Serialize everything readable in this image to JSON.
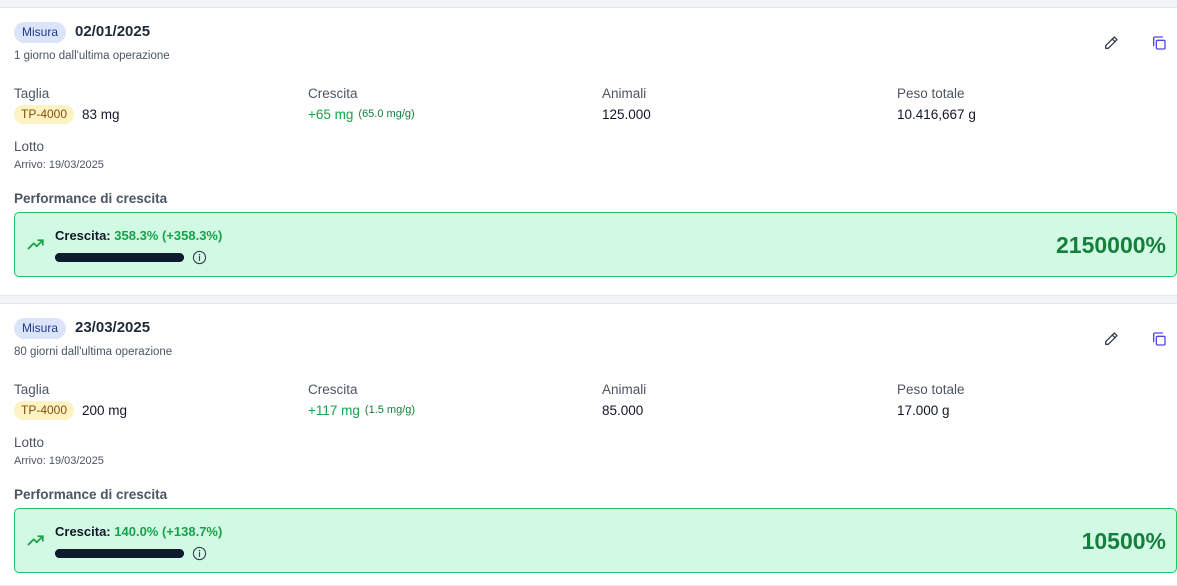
{
  "records": [
    {
      "badge": "Misura",
      "date": "02/01/2025",
      "since": "1 giorno dall'ultima operazione",
      "taglia_label": "Taglia",
      "taglia_tag": "TP-4000",
      "taglia_value": "83 mg",
      "crescita_label": "Crescita",
      "crescita_value": "+65 mg",
      "crescita_rate": "(65.0 mg/g)",
      "animali_label": "Animali",
      "animali_value": "125.000",
      "peso_label": "Peso totale",
      "peso_value": "10.416,667 g",
      "lotto_label": "Lotto",
      "arrivo": "Arrivo: 19/03/2025",
      "perf_title": "Performance di crescita",
      "perf_prefix": "Crescita:",
      "perf_value": "358.3% (+358.3%)",
      "perf_bar_fraction": 1.0,
      "perf_big": "2150000%"
    },
    {
      "badge": "Misura",
      "date": "23/03/2025",
      "since": "80 giorni dall'ultima operazione",
      "taglia_label": "Taglia",
      "taglia_tag": "TP-4000",
      "taglia_value": "200 mg",
      "crescita_label": "Crescita",
      "crescita_value": "+117 mg",
      "crescita_rate": "(1.5 mg/g)",
      "animali_label": "Animali",
      "animali_value": "85.000",
      "peso_label": "Peso totale",
      "peso_value": "17.000 g",
      "lotto_label": "Lotto",
      "arrivo": "Arrivo: 19/03/2025",
      "perf_title": "Performance di crescita",
      "perf_prefix": "Crescita:",
      "perf_value": "140.0% (+138.7%)",
      "perf_bar_fraction": 1.0,
      "perf_big": "10500%"
    }
  ],
  "icons": {
    "edit": "pencil-icon",
    "copy": "copy-icon",
    "trend": "trending-up-icon",
    "info": "info-icon"
  },
  "colors": {
    "accent_green": "#16a34a",
    "perf_bg": "#d2f9e3",
    "badge_bg": "#dbe4fb",
    "tag_bg": "#fdf3c2",
    "icon_blue": "#4f46e5"
  }
}
